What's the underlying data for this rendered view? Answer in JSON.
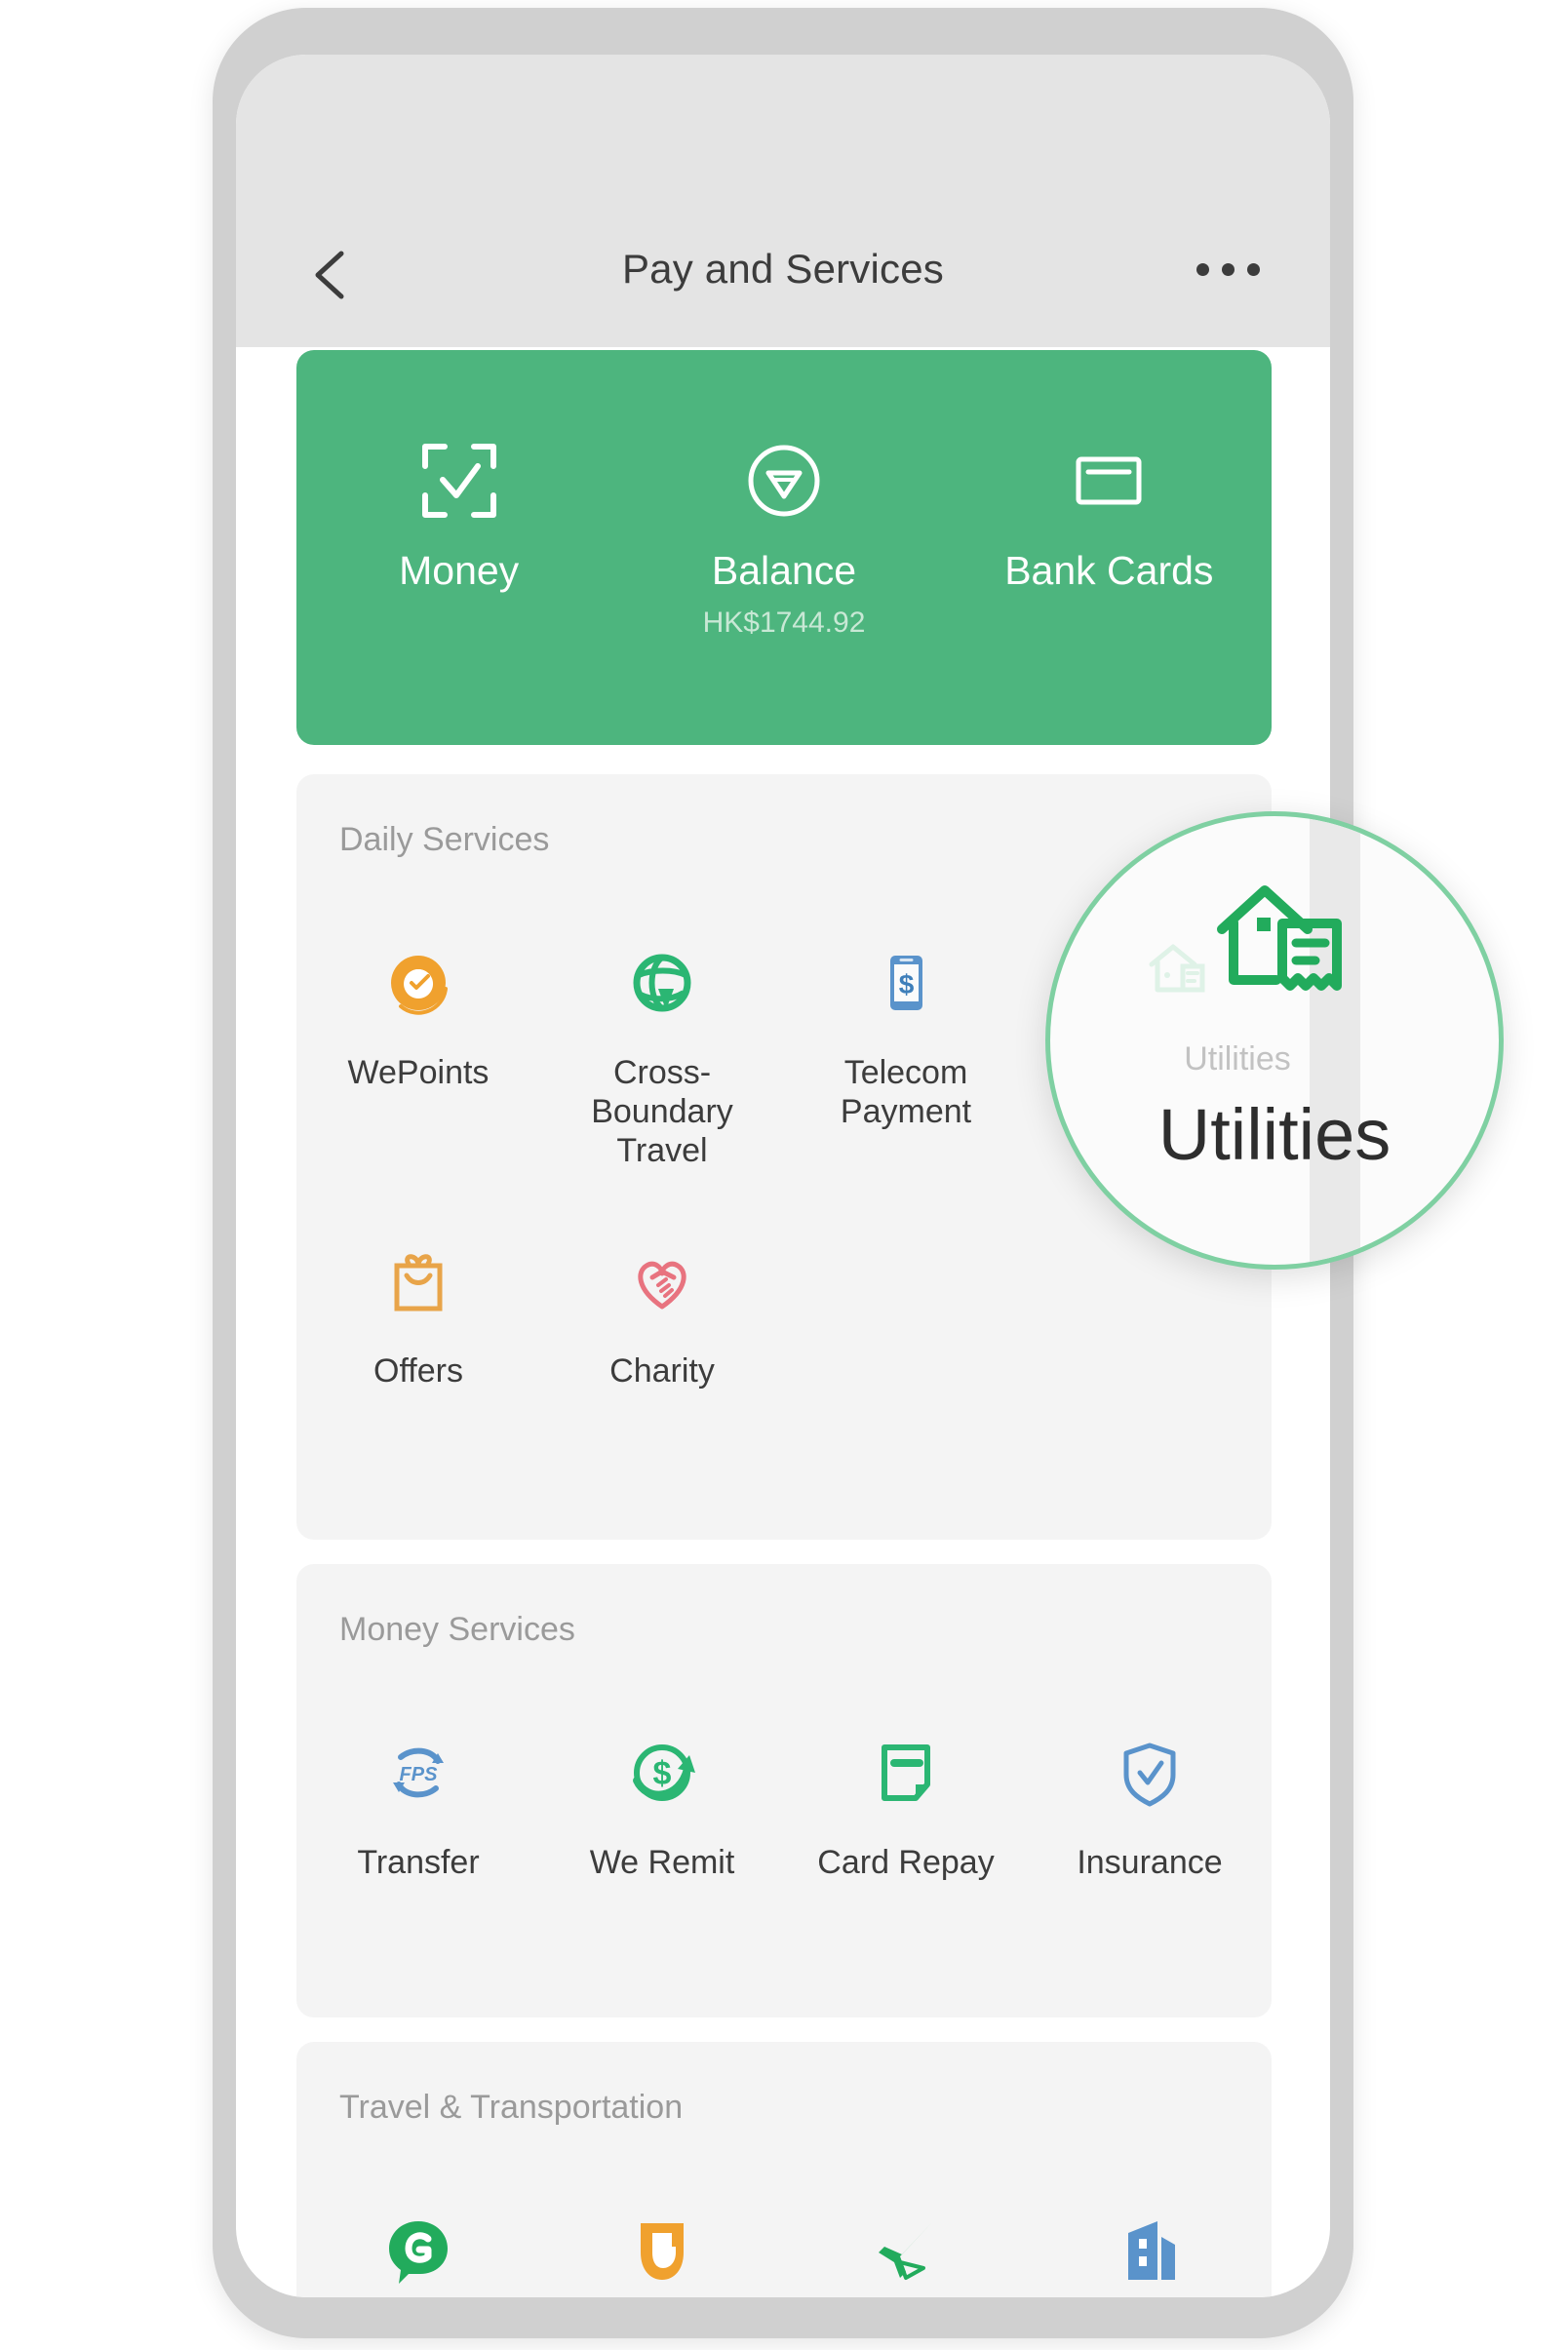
{
  "colors": {
    "brand_green": "#4db57e",
    "lens_ring": "#7fd0a2",
    "card_bg": "#f4f4f4",
    "navbar_bg": "#e4e4e4",
    "section_title": "#9a9a9a",
    "label": "#3c3c3c"
  },
  "navbar": {
    "back_icon": "chevron-left-icon",
    "title": "Pay and Services",
    "more_icon": "more-horizontal-icon"
  },
  "hero": {
    "items": [
      {
        "icon": "scan-money-icon",
        "label": "Money",
        "sub": ""
      },
      {
        "icon": "balance-gem-icon",
        "label": "Balance",
        "sub": "HK$1744.92"
      },
      {
        "icon": "bank-card-icon",
        "label": "Bank Cards",
        "sub": ""
      }
    ]
  },
  "sections": [
    {
      "id": "daily",
      "title": "Daily Services",
      "items": [
        {
          "icon": "wepoints-icon",
          "label": "WePoints"
        },
        {
          "icon": "globe-travel-icon",
          "label": "Cross-\nBoundary\nTravel"
        },
        {
          "icon": "phone-dollar-icon",
          "label": "Telecom\nPayment"
        },
        {
          "icon": "utilities-house-icon",
          "label": "Utilities"
        },
        {
          "icon": "gift-bag-icon",
          "label": "Offers"
        },
        {
          "icon": "charity-heart-icon",
          "label": "Charity"
        }
      ]
    },
    {
      "id": "money",
      "title": "Money Services",
      "items": [
        {
          "icon": "fps-transfer-icon",
          "label": "Transfer"
        },
        {
          "icon": "we-remit-icon",
          "label": "We Remit"
        },
        {
          "icon": "card-repay-icon",
          "label": "Card Repay"
        },
        {
          "icon": "insurance-shield-icon",
          "label": "Insurance"
        }
      ]
    },
    {
      "id": "travel",
      "title": "Travel & Transportation",
      "items": [
        {
          "icon": "g-chat-icon",
          "label": ""
        },
        {
          "icon": "didi-shield-icon",
          "label": ""
        },
        {
          "icon": "airplane-icon",
          "label": ""
        },
        {
          "icon": "buildings-icon",
          "label": ""
        }
      ]
    }
  ],
  "lens": {
    "target_icon": "utilities-house-icon",
    "small_label": "Utilities",
    "big_label": "Utilities"
  }
}
